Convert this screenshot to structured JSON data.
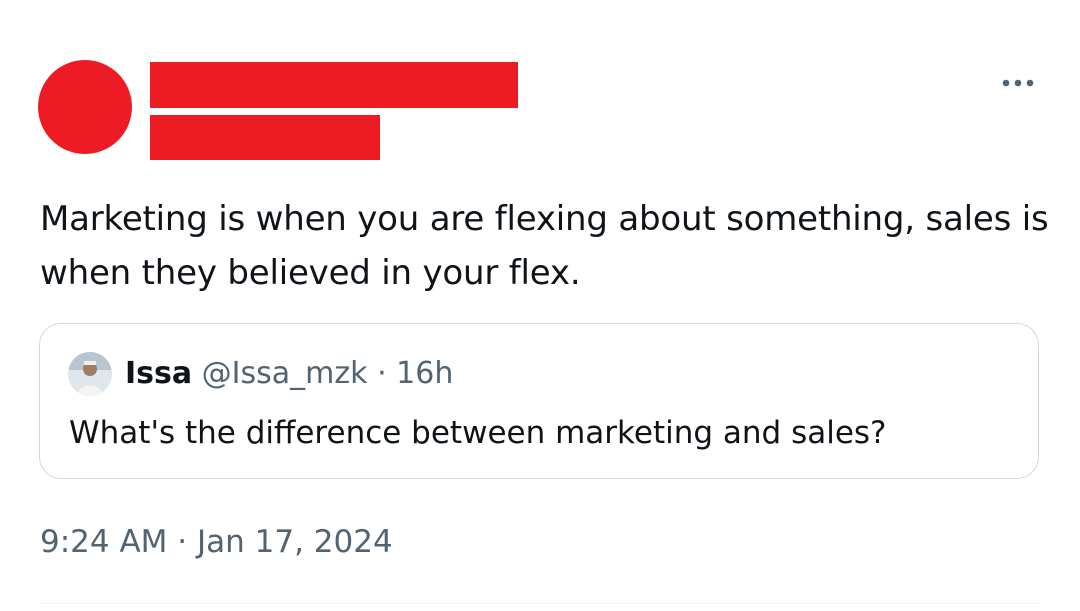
{
  "colors": {
    "redaction": "#ed1c24",
    "secondary_text": "#536471",
    "border": "#cfd9de"
  },
  "tweet": {
    "more_icon": "more-horizontal-icon",
    "text": "Marketing is when you are flexing about something, sales is when they believed in your flex.",
    "quoted": {
      "name": "Issa",
      "handle": "@Issa_mzk",
      "separator": "·",
      "time": "16h",
      "text": "What's the difference between marketing and sales?"
    },
    "timestamp": {
      "time": "9:24 AM",
      "separator": "·",
      "date": "Jan 17, 2024"
    }
  }
}
